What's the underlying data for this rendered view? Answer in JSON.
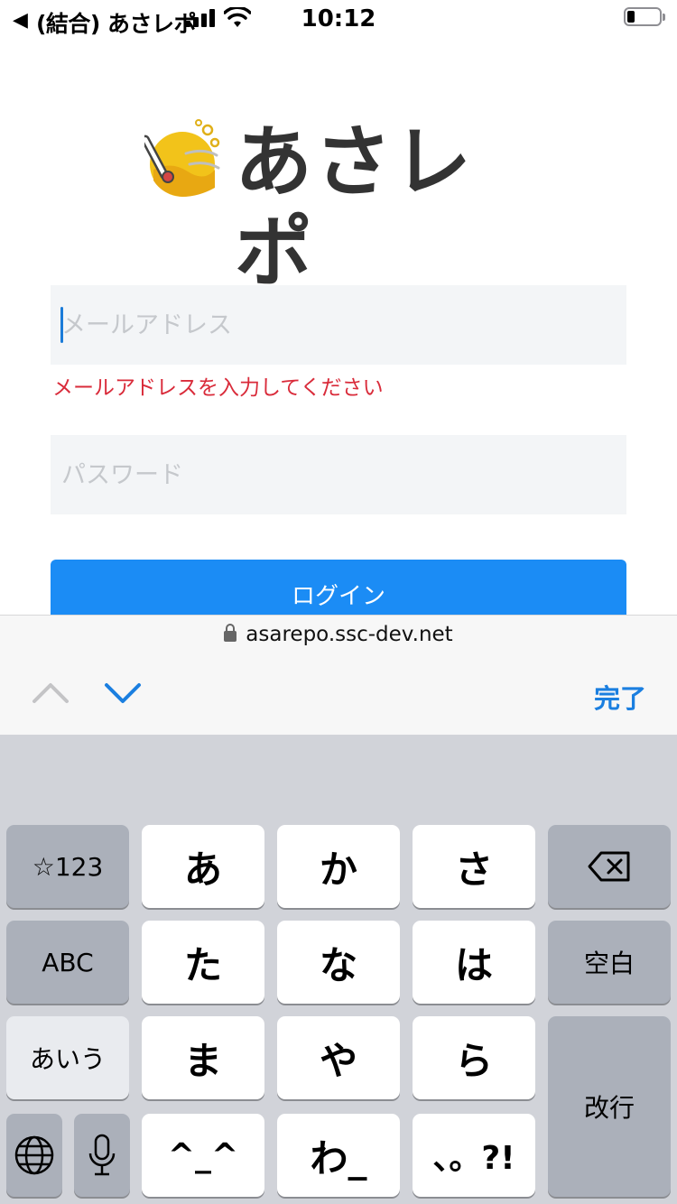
{
  "status_bar": {
    "back": "◀",
    "carrier": "(結合) あさレポ",
    "time": "10:12"
  },
  "logo": {
    "text": "あさレポ"
  },
  "form": {
    "email_placeholder": "メールアドレス",
    "email_error": "メールアドレスを入力してください",
    "password_placeholder": "パスワード",
    "login_label": "ログイン"
  },
  "url_bar": {
    "url": "asarepo.ssc-dev.net"
  },
  "accessory": {
    "done_label": "完了"
  },
  "keyboard": {
    "num_key": "☆123",
    "abc_key": "ABC",
    "aiu_key": "あいう",
    "space_key": "空白",
    "return_key": "改行",
    "rows": [
      [
        "あ",
        "か",
        "さ"
      ],
      [
        "た",
        "な",
        "は"
      ],
      [
        "ま",
        "や",
        "ら"
      ],
      [
        "^_^",
        "わ_",
        "、。?!"
      ]
    ]
  },
  "colors": {
    "accent": "#1b8cf5",
    "error": "#d92b3a",
    "done": "#1b7fe0"
  }
}
